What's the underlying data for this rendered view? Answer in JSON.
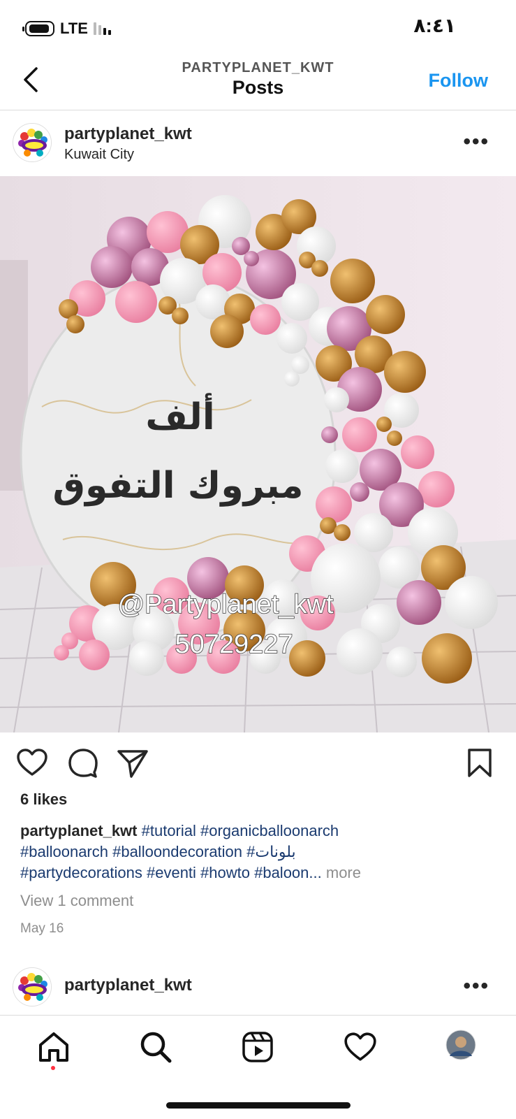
{
  "status_bar": {
    "network": "LTE",
    "time": "٨:٤١"
  },
  "header": {
    "account": "PARTYPLANET_KWT",
    "title": "Posts",
    "follow_label": "Follow"
  },
  "post": {
    "username": "partyplanet_kwt",
    "location": "Kuwait City",
    "image_text": {
      "arabic_line1": "ألف",
      "arabic_line2": "مبروك التفوق",
      "handle": "@Partyplanet_kwt",
      "phone": "50729227"
    },
    "likes": "6 likes",
    "caption_user": "partyplanet_kwt",
    "caption_tags_line1": "#tutorial #organicballoonarch",
    "caption_tags_line2": "#balloonarch #balloondecoration #بلونات",
    "caption_tags_line3": "#partydecorations #eventi #howto #baloon...",
    "more_label": "more",
    "view_comments": "View 1 comment",
    "date": "May 16"
  },
  "next_post": {
    "username": "partyplanet_kwt"
  },
  "colors": {
    "accent": "#1a95f0",
    "hashtag": "#1b3b70",
    "muted": "#8e8e8e"
  }
}
